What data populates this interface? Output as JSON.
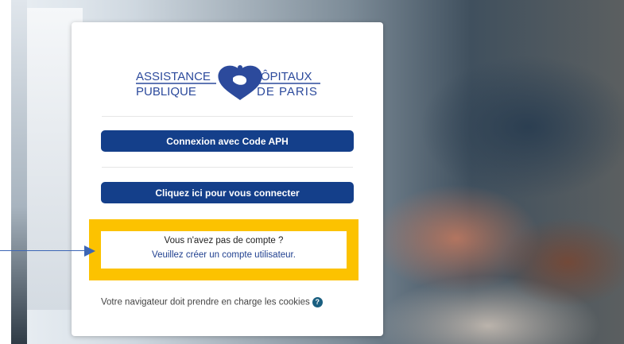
{
  "logo": {
    "line1_left": "ASSISTANCE",
    "line2_left": "PUBLIQUE",
    "line1_right": "HÔPITAUX",
    "line2_right": "DE PARIS",
    "color": "#2c4a9c"
  },
  "buttons": {
    "aph_login": "Connexion avec Code APH",
    "connect": "Cliquez ici pour vous connecter"
  },
  "signup": {
    "question": "Vous n'avez pas de compte ?",
    "link": "Veuillez créer un compte utilisateur."
  },
  "cookies_notice": "Votre navigateur doit prendre en charge les cookies",
  "colors": {
    "button_bg": "#143f8a",
    "highlight": "#fcc200",
    "arrow": "#3d66b5",
    "help_icon": "#1a5f80"
  },
  "icons": {
    "help": "question-circle-icon",
    "logo_mark": "heart-emblem-icon"
  }
}
